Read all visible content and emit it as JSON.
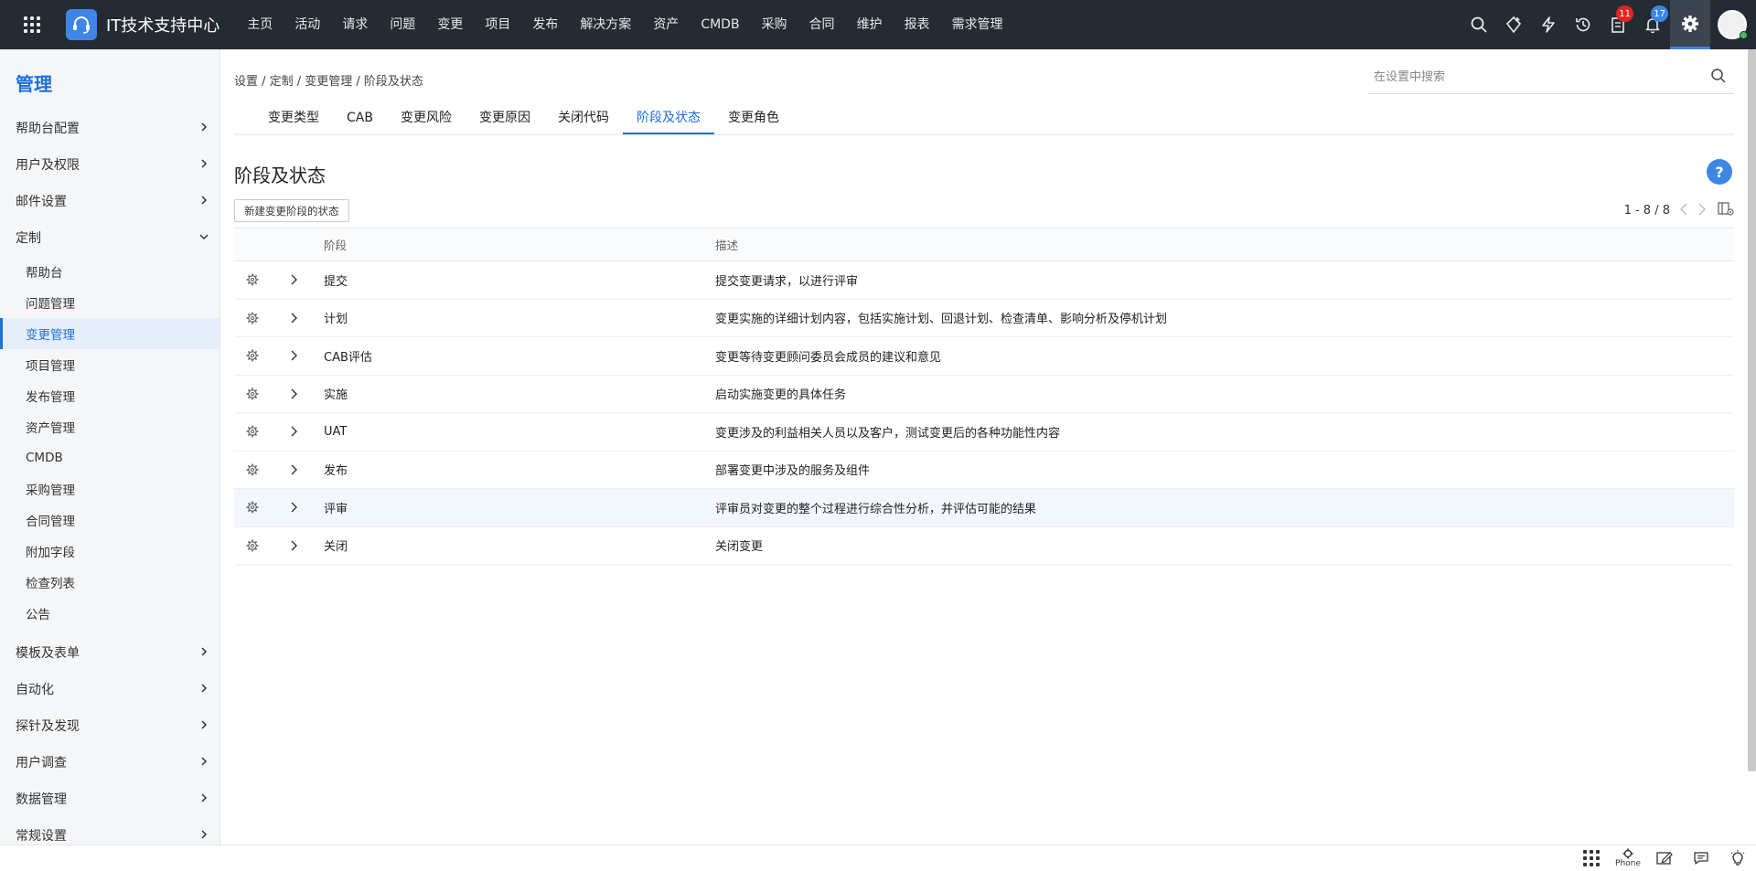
{
  "app": {
    "title": "IT技术支持中心"
  },
  "topnav": [
    "主页",
    "活动",
    "请求",
    "问题",
    "变更",
    "项目",
    "发布",
    "解决方案",
    "资产",
    "CMDB",
    "采购",
    "合同",
    "维护",
    "报表",
    "需求管理"
  ],
  "badges": {
    "tasks": "11",
    "notifications": "17"
  },
  "sidebar": {
    "title": "管理",
    "sections_top": [
      "帮助台配置",
      "用户及权限",
      "邮件设置"
    ],
    "customize": "定制",
    "customize_items": [
      "帮助台",
      "问题管理",
      "变更管理",
      "项目管理",
      "发布管理",
      "资产管理",
      "CMDB",
      "采购管理",
      "合同管理",
      "附加字段",
      "检查列表",
      "公告"
    ],
    "sections_bottom": [
      "模板及表单",
      "自动化",
      "探针及发现",
      "用户调查",
      "数据管理",
      "常规设置"
    ]
  },
  "breadcrumb": "设置 / 定制 / 变更管理 / 阶段及状态",
  "search": {
    "placeholder": "在设置中搜索"
  },
  "tabs": [
    "变更类型",
    "CAB",
    "变更风险",
    "变更原因",
    "关闭代码",
    "阶段及状态",
    "变更角色"
  ],
  "page": {
    "title": "阶段及状态",
    "help": "?",
    "new_button": "新建变更阶段的状态",
    "pager": "1 - 8 / 8"
  },
  "table": {
    "headers": {
      "stage": "阶段",
      "desc": "描述"
    },
    "rows": [
      {
        "stage": "提交",
        "desc": "提交变更请求，以进行评审"
      },
      {
        "stage": "计划",
        "desc": "变更实施的详细计划内容，包括实施计划、回退计划、检查清单、影响分析及停机计划"
      },
      {
        "stage": "CAB评估",
        "desc": "变更等待变更顾问委员会成员的建议和意见"
      },
      {
        "stage": "实施",
        "desc": "启动实施变更的具体任务"
      },
      {
        "stage": "UAT",
        "desc": "变更涉及的利益相关人员以及客户，测试变更后的各种功能性内容"
      },
      {
        "stage": "发布",
        "desc": "部署变更中涉及的服务及组件"
      },
      {
        "stage": "评审",
        "desc": "评审员对变更的整个过程进行综合性分析，并评估可能的结果"
      },
      {
        "stage": "关闭",
        "desc": "关闭变更"
      }
    ]
  },
  "bottombar": {
    "phone_label": "Phone"
  },
  "colors": {
    "accent": "#1f6fd8",
    "topbar": "#252b33",
    "badge_red": "#e02424",
    "badge_blue": "#3d86e6"
  }
}
